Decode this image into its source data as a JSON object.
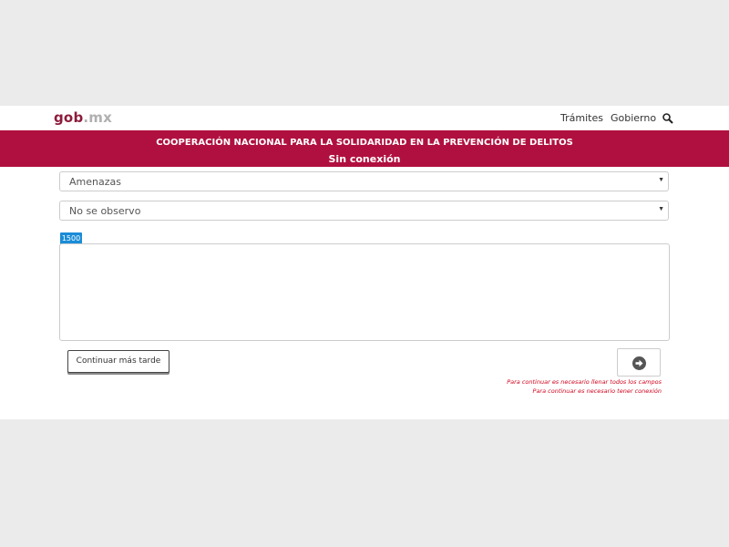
{
  "navbar": {
    "logo_part1": "gob",
    "logo_part2": ".mx",
    "links": [
      "Trámites",
      "Gobierno"
    ],
    "search_icon": "search-icon"
  },
  "banner": {
    "title": "COOPERACIÓN NACIONAL PARA LA SOLIDARIDAD EN LA PREVENCIÓN DE DELITOS",
    "status": "Sin conexión"
  },
  "form": {
    "select1_value": "Amenazas",
    "select2_value": "No se observo",
    "char_counter": "1500",
    "textarea_value": "",
    "later_button": "Continuar más tarde",
    "next_icon": "arrow-right-circle-icon",
    "errors": [
      "Para continuar es necesario llenar todos los campos",
      "Para continuar es necesario tener conexión"
    ]
  },
  "colors": {
    "brand": "#b0103f",
    "logo": "#8c1c3c",
    "counter": "#1a8cd8",
    "error": "#d0021b"
  }
}
